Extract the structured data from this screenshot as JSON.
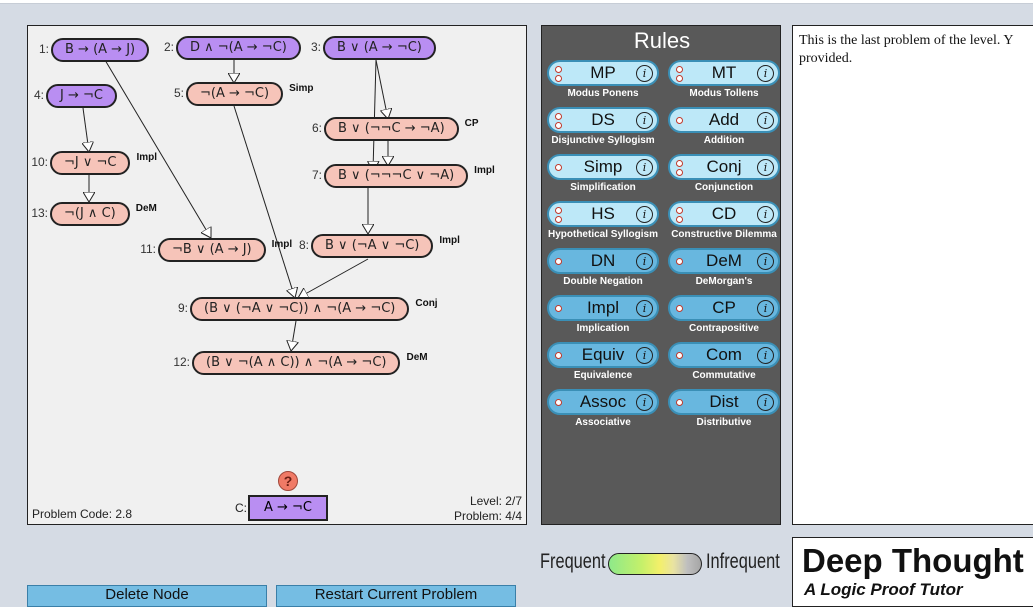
{
  "proof": {
    "nodes": [
      {
        "num": "1:",
        "formula": "B → (A → J)",
        "type": "premise",
        "rule": ""
      },
      {
        "num": "2:",
        "formula": "D ∧ ¬(A → ¬C)",
        "type": "premise",
        "rule": ""
      },
      {
        "num": "3:",
        "formula": "B ∨ (A → ¬C)",
        "type": "premise",
        "rule": ""
      },
      {
        "num": "4:",
        "formula": "J → ¬C",
        "type": "premise",
        "rule": ""
      },
      {
        "num": "5:",
        "formula": "¬(A → ¬C)",
        "type": "derived",
        "rule": "Simp"
      },
      {
        "num": "6:",
        "formula": "B ∨ (¬¬C → ¬A)",
        "type": "derived",
        "rule": "CP"
      },
      {
        "num": "7:",
        "formula": "B ∨ (¬¬¬C ∨ ¬A)",
        "type": "derived",
        "rule": "Impl"
      },
      {
        "num": "10:",
        "formula": "¬J ∨ ¬C",
        "type": "derived",
        "rule": "Impl"
      },
      {
        "num": "13:",
        "formula": "¬(J ∧ C)",
        "type": "derived",
        "rule": "DeM"
      },
      {
        "num": "11:",
        "formula": "¬B ∨ (A → J)",
        "type": "derived",
        "rule": "Impl"
      },
      {
        "num": "8:",
        "formula": "B ∨ (¬A ∨ ¬C)",
        "type": "derived",
        "rule": "Impl"
      },
      {
        "num": "9:",
        "formula": "(B ∨ (¬A ∨ ¬C)) ∧ ¬(A → ¬C)",
        "type": "derived",
        "rule": "Conj"
      },
      {
        "num": "12:",
        "formula": "(B ∨ ¬(A ∧ C)) ∧ ¬(A → ¬C)",
        "type": "derived",
        "rule": "DeM"
      }
    ],
    "goal_label": "C:",
    "goal": "A → ¬C",
    "help_icon": "?",
    "problem_code": "Problem Code: 2.8",
    "level": "Level: 2/7",
    "problem": "Problem: 4/4"
  },
  "rules": {
    "title": "Rules",
    "items": [
      {
        "short": "MP",
        "full": "Modus Ponens",
        "premises": 2
      },
      {
        "short": "MT",
        "full": "Modus Tollens",
        "premises": 2
      },
      {
        "short": "DS",
        "full": "Disjunctive Syllogism",
        "premises": 2
      },
      {
        "short": "Add",
        "full": "Addition",
        "premises": 1
      },
      {
        "short": "Simp",
        "full": "Simplification",
        "premises": 1
      },
      {
        "short": "Conj",
        "full": "Conjunction",
        "premises": 2
      },
      {
        "short": "HS",
        "full": "Hypothetical Syllogism",
        "premises": 2
      },
      {
        "short": "CD",
        "full": "Constructive Dilemma",
        "premises": 2
      },
      {
        "short": "DN",
        "full": "Double Negation",
        "premises": 1
      },
      {
        "short": "DeM",
        "full": "DeMorgan's",
        "premises": 1
      },
      {
        "short": "Impl",
        "full": "Implication",
        "premises": 1
      },
      {
        "short": "CP",
        "full": "Contrapositive",
        "premises": 1
      },
      {
        "short": "Equiv",
        "full": "Equivalence",
        "premises": 1
      },
      {
        "short": "Com",
        "full": "Commutative",
        "premises": 1
      },
      {
        "short": "Assoc",
        "full": "Associative",
        "premises": 1
      },
      {
        "short": "Dist",
        "full": "Distributive",
        "premises": 1
      }
    ],
    "info_icon": "i",
    "colors": {
      "light": "#bde8f8",
      "dark": "#68b7df",
      "border": "#3a8fb6"
    }
  },
  "message": "This is the last problem of the level. Y provided.",
  "bottom": {
    "delete_label": "Delete Node",
    "restart_label": "Restart Current Problem",
    "frequent_label": "Frequent",
    "infrequent_label": "Infrequent"
  },
  "brand": {
    "title": "Deep Thought",
    "subtitle": "A Logic Proof Tutor"
  },
  "colors": {
    "premise": "#b98ef2",
    "derived": "#f6c4b9",
    "background": "#d5dbe4"
  }
}
